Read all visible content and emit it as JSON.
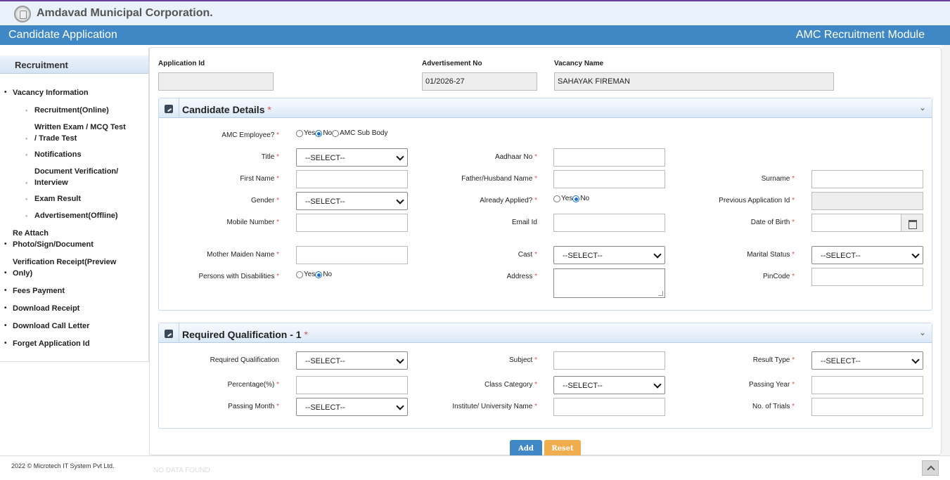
{
  "header": {
    "org_title": "Amdavad Municipal Corporation.",
    "page_title": "Candidate Application",
    "module_title": "AMC Recruitment Module"
  },
  "sidebar": {
    "heading": "Recruitment",
    "items": [
      {
        "label_lines": [
          "Vacancy Information"
        ],
        "level": 1
      },
      {
        "label_lines": [
          "Recruitment(Online)"
        ],
        "level": 2
      },
      {
        "label_lines": [
          "Written Exam / MCQ Test",
          "/ Trade Test"
        ],
        "level": 2
      },
      {
        "label_lines": [
          "Notifications"
        ],
        "level": 2
      },
      {
        "label_lines": [
          "Document Verification/",
          "Interview"
        ],
        "level": 2
      },
      {
        "label_lines": [
          "Exam Result"
        ],
        "level": 2
      },
      {
        "label_lines": [
          "Advertisement(Offline)"
        ],
        "level": 2
      },
      {
        "label_lines": [
          "Re Attach",
          "Photo/Sign/Document"
        ],
        "level": 1
      },
      {
        "label_lines": [
          "Verification Receipt(Preview",
          "Only)"
        ],
        "level": 1
      },
      {
        "label_lines": [
          "Fees Payment"
        ],
        "level": 1
      },
      {
        "label_lines": [
          "Download Receipt"
        ],
        "level": 1
      },
      {
        "label_lines": [
          "Download Call Letter"
        ],
        "level": 1
      },
      {
        "label_lines": [
          "Forget Application Id"
        ],
        "level": 1
      }
    ]
  },
  "top_fields": {
    "application_id": {
      "label": "Application Id",
      "value": ""
    },
    "advertisement_no": {
      "label": "Advertisement No",
      "value": "01/2026-27"
    },
    "vacancy_name": {
      "label": "Vacancy Name",
      "value": "SAHAYAK FIREMAN"
    }
  },
  "candidate": {
    "title": "Candidate Details",
    "required_mark": "*",
    "amc_employee": {
      "label": "AMC Employee?",
      "options": [
        "Yes",
        "No",
        "AMC Sub Body"
      ],
      "selected": "No"
    },
    "title_field": {
      "label": "Title",
      "value": "--SELECT--"
    },
    "aadhaar": {
      "label": "Aadhaar No"
    },
    "first_name": {
      "label": "First Name"
    },
    "father_name": {
      "label": "Father/Husband Name"
    },
    "surname": {
      "label": "Surname"
    },
    "gender": {
      "label": "Gender",
      "value": "--SELECT--"
    },
    "already_applied": {
      "label": "Already Applied?",
      "options": [
        "Yes",
        "No"
      ],
      "selected": "No"
    },
    "prev_app_id": {
      "label": "Previous Application Id"
    },
    "mobile": {
      "label": "Mobile Number"
    },
    "email": {
      "label": "Email Id"
    },
    "dob": {
      "label": "Date of Birth"
    },
    "mother_maiden": {
      "label": "Mother Maiden Name"
    },
    "cast": {
      "label": "Cast",
      "value": "--SELECT--"
    },
    "marital": {
      "label": "Marital Status",
      "value": "--SELECT--"
    },
    "pwd": {
      "label": "Persons with Disabilities",
      "options": [
        "Yes",
        "No"
      ],
      "selected": "No"
    },
    "address": {
      "label": "Address"
    },
    "pincode": {
      "label": "PinCode"
    }
  },
  "qualification": {
    "title": "Required Qualification - 1",
    "required_mark": "*",
    "req_qual": {
      "label": "Required Qualification",
      "value": "--SELECT--"
    },
    "subject": {
      "label": "Subject"
    },
    "result_type": {
      "label": "Result Type",
      "value": "--SELECT--"
    },
    "percentage": {
      "label": "Percentage(%)"
    },
    "class_category": {
      "label": "Class Category",
      "value": "--SELECT--"
    },
    "passing_year": {
      "label": "Passing Year"
    },
    "passing_month": {
      "label": "Passing Month",
      "value": "--SELECT--"
    },
    "institute": {
      "label": "Institute/ University Name"
    },
    "trials": {
      "label": "No. of Trials"
    }
  },
  "actions": {
    "add_label": "Add",
    "reset_label": "Reset"
  },
  "footer": {
    "copyright": "2022 © Microtech IT System Pvt Ltd.",
    "no_data": "NO DATA FOUND"
  },
  "icons": [
    "logo-emblem",
    "edit-icon",
    "chevron-down-icon",
    "calendar-icon",
    "scroll-top-icon"
  ]
}
